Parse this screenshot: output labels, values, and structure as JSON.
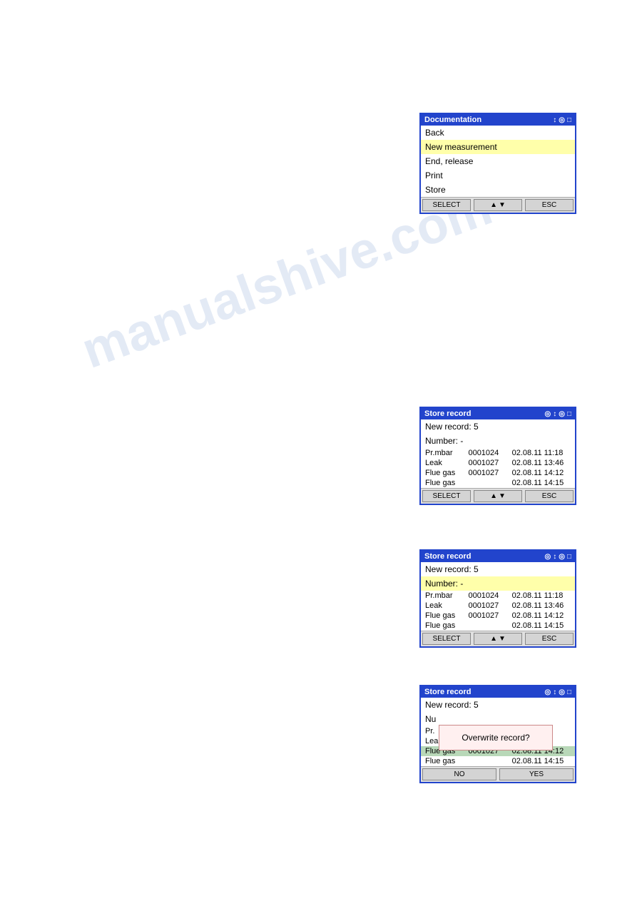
{
  "watermark": "manualshive.com",
  "panel1": {
    "title": "Documentation",
    "title_icons": [
      "↕",
      "◎",
      "□"
    ],
    "items": [
      {
        "label": "Back",
        "selected": false
      },
      {
        "label": "New measurement",
        "selected": true
      },
      {
        "label": "End, release",
        "selected": false
      },
      {
        "label": "Print",
        "selected": false
      },
      {
        "label": "Store",
        "selected": false
      }
    ],
    "toolbar": {
      "select_label": "SELECT",
      "nav_label": "▲▼",
      "esc_label": "ESC"
    }
  },
  "panel2": {
    "title": "Store record",
    "title_icons": [
      "◎",
      "↕",
      "◎",
      "□"
    ],
    "new_record_label": "New record: 5",
    "number_label": "Number: -",
    "rows": [
      {
        "type": "Pr.mbar",
        "id": "0001024",
        "date": "02.08.11 11:18",
        "highlighted": false
      },
      {
        "type": "Leak",
        "id": "0001027",
        "date": "02.08.11 13:46",
        "highlighted": false
      },
      {
        "type": "Flue gas",
        "id": "0001027",
        "date": "02.08.11 14:12",
        "highlighted": false
      },
      {
        "type": "Flue gas",
        "id": "",
        "date": "02.08.11 14:15",
        "highlighted": false
      }
    ],
    "toolbar": {
      "select_label": "SELECT",
      "nav_label": "▲▼",
      "esc_label": "ESC"
    }
  },
  "panel3": {
    "title": "Store record",
    "title_icons": [
      "◎",
      "↕",
      "◎",
      "□"
    ],
    "new_record_label": "New record: 5",
    "number_label": "Number: -",
    "number_highlighted": true,
    "rows": [
      {
        "type": "Pr.mbar",
        "id": "0001024",
        "date": "02.08.11 11:18",
        "highlighted": false
      },
      {
        "type": "Leak",
        "id": "0001027",
        "date": "02.08.11 13:46",
        "highlighted": false
      },
      {
        "type": "Flue gas",
        "id": "0001027",
        "date": "02.08.11 14:12",
        "highlighted": false
      },
      {
        "type": "Flue gas",
        "id": "",
        "date": "02.08.11 14:15",
        "highlighted": false
      }
    ],
    "toolbar": {
      "select_label": "SELECT",
      "nav_label": "▲▼",
      "esc_label": "ESC"
    }
  },
  "panel4": {
    "title": "Store record",
    "title_icons": [
      "◎",
      "↕",
      "◎",
      "□"
    ],
    "new_record_label": "New record: 5",
    "number_label": "Nu",
    "rows": [
      {
        "type": "Pr.",
        "id": "",
        "date": "",
        "highlighted": false,
        "partial": true
      },
      {
        "type": "Lea",
        "id": "",
        "date": "",
        "highlighted": false,
        "partial": true
      },
      {
        "type": "Flue gas",
        "id": "0001027",
        "date": "02.08.11 14:12",
        "highlighted": true
      },
      {
        "type": "Flue gas",
        "id": "",
        "date": "02.08.11 14:15",
        "highlighted": false
      }
    ],
    "dialog": {
      "message": "Overwrite record?"
    },
    "toolbar": {
      "no_label": "NO",
      "yes_label": "YES"
    }
  }
}
